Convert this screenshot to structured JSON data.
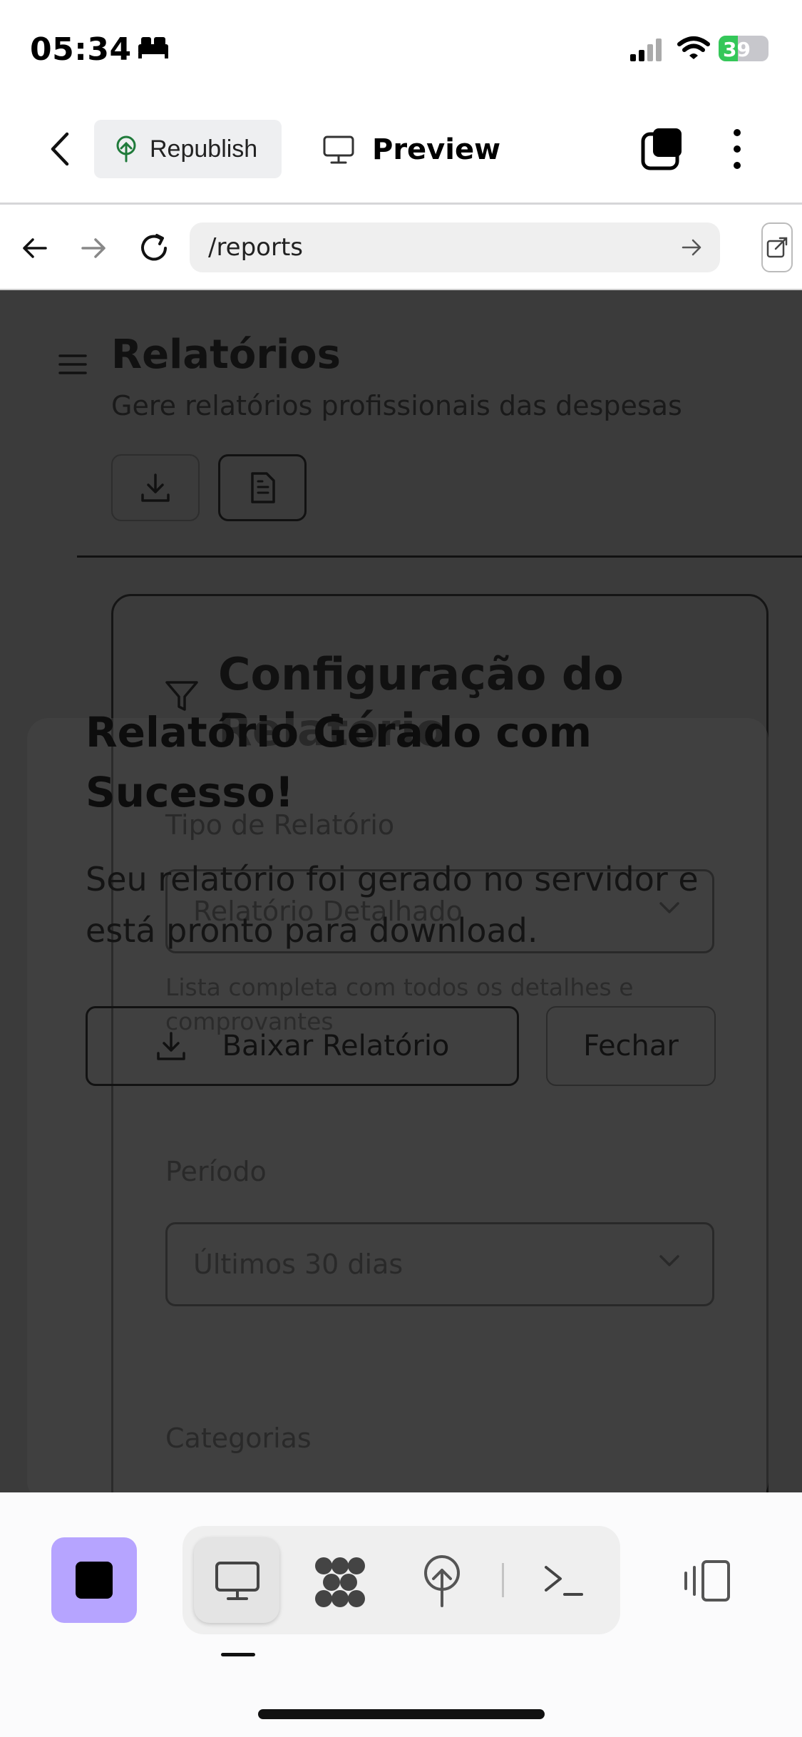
{
  "status_bar": {
    "time": "05:34",
    "battery": {
      "level": 39,
      "label": "39"
    }
  },
  "header": {
    "republish_label": "Republish",
    "preview_label": "Preview"
  },
  "browser": {
    "url": "/reports"
  },
  "page": {
    "title": "Relatórios",
    "subtitle": "Gere relatórios profissionais das despesas"
  },
  "config": {
    "title": "Configuração do Relatório",
    "report_type_label": "Tipo de Relatório",
    "report_type_value": "Relatório Detalhado",
    "report_type_hint": "Lista completa com todos os detalhes e comprovantes",
    "period_label": "Período",
    "period_value": "Últimos 30 dias",
    "categories_label": "Categorias"
  },
  "toast": {
    "title": "Relatório Gerado com Sucesso!",
    "description": "Seu relatório foi gerado no servidor e está pronto para download.",
    "download_label": "Baixar Relatório",
    "close_label": "Fechar"
  },
  "colors": {
    "accent": "#b6a4ff",
    "battery": "#34c759",
    "overlay": "#3b3b3b"
  }
}
